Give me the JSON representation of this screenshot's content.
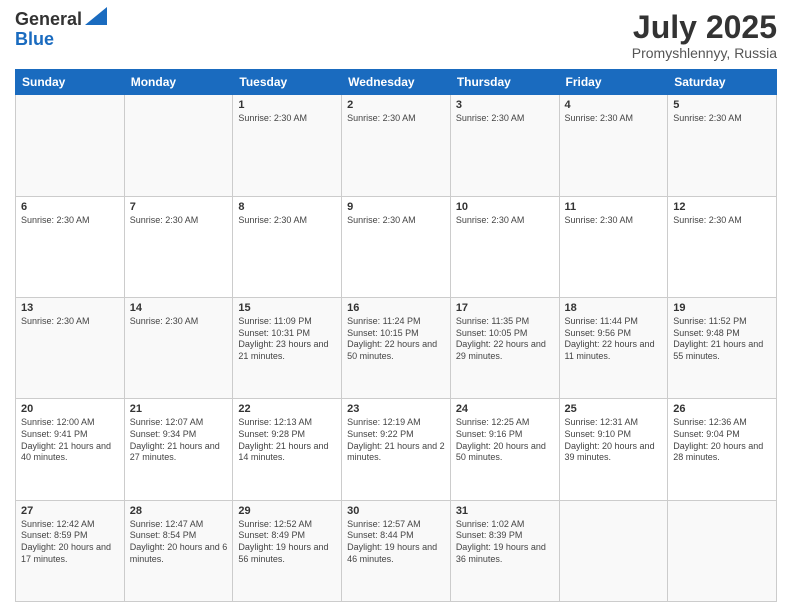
{
  "header": {
    "logo_line1": "General",
    "logo_line2": "Blue",
    "month": "July 2025",
    "location": "Promyshlennyy, Russia"
  },
  "weekdays": [
    "Sunday",
    "Monday",
    "Tuesday",
    "Wednesday",
    "Thursday",
    "Friday",
    "Saturday"
  ],
  "weeks": [
    [
      {
        "day": "",
        "text": ""
      },
      {
        "day": "",
        "text": ""
      },
      {
        "day": "1",
        "text": "Sunrise: 2:30 AM"
      },
      {
        "day": "2",
        "text": "Sunrise: 2:30 AM"
      },
      {
        "day": "3",
        "text": "Sunrise: 2:30 AM"
      },
      {
        "day": "4",
        "text": "Sunrise: 2:30 AM"
      },
      {
        "day": "5",
        "text": "Sunrise: 2:30 AM"
      }
    ],
    [
      {
        "day": "6",
        "text": "Sunrise: 2:30 AM"
      },
      {
        "day": "7",
        "text": "Sunrise: 2:30 AM"
      },
      {
        "day": "8",
        "text": "Sunrise: 2:30 AM"
      },
      {
        "day": "9",
        "text": "Sunrise: 2:30 AM"
      },
      {
        "day": "10",
        "text": "Sunrise: 2:30 AM"
      },
      {
        "day": "11",
        "text": "Sunrise: 2:30 AM"
      },
      {
        "day": "12",
        "text": "Sunrise: 2:30 AM"
      }
    ],
    [
      {
        "day": "13",
        "text": "Sunrise: 2:30 AM"
      },
      {
        "day": "14",
        "text": "Sunrise: 2:30 AM"
      },
      {
        "day": "15",
        "text": "Sunrise: 11:09 PM\nSunset: 10:31 PM\nDaylight: 23 hours and 21 minutes."
      },
      {
        "day": "16",
        "text": "Sunrise: 11:24 PM\nSunset: 10:15 PM\nDaylight: 22 hours and 50 minutes."
      },
      {
        "day": "17",
        "text": "Sunrise: 11:35 PM\nSunset: 10:05 PM\nDaylight: 22 hours and 29 minutes."
      },
      {
        "day": "18",
        "text": "Sunrise: 11:44 PM\nSunset: 9:56 PM\nDaylight: 22 hours and 11 minutes."
      },
      {
        "day": "19",
        "text": "Sunrise: 11:52 PM\nSunset: 9:48 PM\nDaylight: 21 hours and 55 minutes."
      }
    ],
    [
      {
        "day": "20",
        "text": "Sunrise: 12:00 AM\nSunset: 9:41 PM\nDaylight: 21 hours and 40 minutes."
      },
      {
        "day": "21",
        "text": "Sunrise: 12:07 AM\nSunset: 9:34 PM\nDaylight: 21 hours and 27 minutes."
      },
      {
        "day": "22",
        "text": "Sunrise: 12:13 AM\nSunset: 9:28 PM\nDaylight: 21 hours and 14 minutes."
      },
      {
        "day": "23",
        "text": "Sunrise: 12:19 AM\nSunset: 9:22 PM\nDaylight: 21 hours and 2 minutes."
      },
      {
        "day": "24",
        "text": "Sunrise: 12:25 AM\nSunset: 9:16 PM\nDaylight: 20 hours and 50 minutes."
      },
      {
        "day": "25",
        "text": "Sunrise: 12:31 AM\nSunset: 9:10 PM\nDaylight: 20 hours and 39 minutes."
      },
      {
        "day": "26",
        "text": "Sunrise: 12:36 AM\nSunset: 9:04 PM\nDaylight: 20 hours and 28 minutes."
      }
    ],
    [
      {
        "day": "27",
        "text": "Sunrise: 12:42 AM\nSunset: 8:59 PM\nDaylight: 20 hours and 17 minutes."
      },
      {
        "day": "28",
        "text": "Sunrise: 12:47 AM\nSunset: 8:54 PM\nDaylight: 20 hours and 6 minutes."
      },
      {
        "day": "29",
        "text": "Sunrise: 12:52 AM\nSunset: 8:49 PM\nDaylight: 19 hours and 56 minutes."
      },
      {
        "day": "30",
        "text": "Sunrise: 12:57 AM\nSunset: 8:44 PM\nDaylight: 19 hours and 46 minutes."
      },
      {
        "day": "31",
        "text": "Sunrise: 1:02 AM\nSunset: 8:39 PM\nDaylight: 19 hours and 36 minutes."
      },
      {
        "day": "",
        "text": ""
      },
      {
        "day": "",
        "text": ""
      }
    ]
  ]
}
